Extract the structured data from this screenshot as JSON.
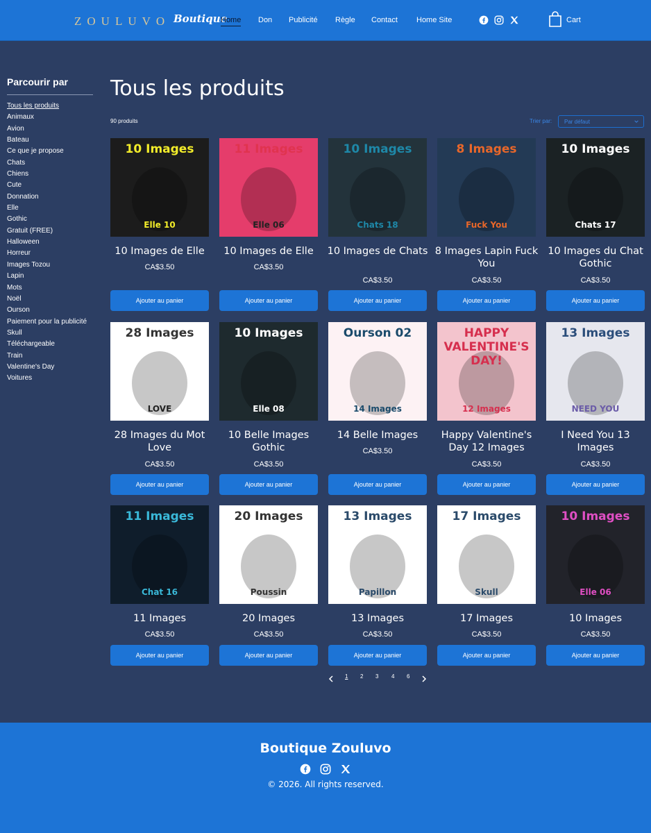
{
  "header": {
    "logo": "ZOULUVO",
    "logo_sub": "Boutique",
    "nav": [
      "Home",
      "Don",
      "Publicité",
      "Règle",
      "Contact",
      "Home Site"
    ],
    "cart": "Cart",
    "social_icons": [
      "facebook-icon",
      "instagram-icon",
      "x-icon"
    ]
  },
  "sidebar": {
    "title": "Parcourir par",
    "items": [
      "Tous les produits",
      "Animaux",
      "Avion",
      "Bateau",
      "Ce que je propose",
      "Chats",
      "Chiens",
      "Cute",
      "Donnation",
      "Elle",
      "Gothic",
      "Gratuit (FREE)",
      "Halloween",
      "Horreur",
      "Images Tozou",
      "Lapin",
      "Mots",
      "Noël",
      "Ourson",
      "Paiement pour la publicité",
      "Skull",
      "Téléchargeable",
      "Train",
      "Valentine's Day",
      "Voitures"
    ]
  },
  "main": {
    "title": "Tous les produits",
    "count": "90 produits",
    "sort_label": "Trier par:",
    "sort_value": "Par défaut",
    "add_label": "Ajouter au panier"
  },
  "products": [
    {
      "name": "10 Images de Elle",
      "price": "CA$3.50",
      "img_top": "10 Images",
      "img_bottom": "Elle 10",
      "bg": "#1c1c1c",
      "top_color": "#f2ec2a",
      "bottom_color": "#f2ec2a"
    },
    {
      "name": "10 Images de Elle",
      "price": "CA$3.50",
      "img_top": "11 Images",
      "img_bottom": "Elle 06",
      "bg": "#e53d6b",
      "top_color": "#e0334f",
      "bottom_color": "#222222"
    },
    {
      "name": "10 Images de Chats",
      "price": "CA$3.50",
      "img_top": "10 Images",
      "img_bottom": "Chats 18",
      "bg": "#23333b",
      "top_color": "#1e88a8",
      "bottom_color": "#1e88a8"
    },
    {
      "name": "8 Images Lapin Fuck You",
      "price": "CA$3.50",
      "img_top": "8 Images",
      "img_bottom": "Fuck You",
      "bg": "#233a55",
      "top_color": "#e8672a",
      "bottom_color": "#e8672a"
    },
    {
      "name": "10 Images du Chat Gothic",
      "price": "CA$3.50",
      "img_top": "10 Images",
      "img_bottom": "Chats 17",
      "bg": "#1b2224",
      "top_color": "#ffffff",
      "bottom_color": "#ffffff"
    },
    {
      "name": "28 Images du Mot Love",
      "price": "CA$3.50",
      "img_top": "28 Images",
      "img_bottom": "LOVE",
      "bg": "#ffffff",
      "top_color": "#333333",
      "bottom_color": "#222222"
    },
    {
      "name": "10 Belle Images Gothic",
      "price": "CA$3.50",
      "img_top": "10 Images",
      "img_bottom": "Elle 08",
      "bg": "#1e2a2e",
      "top_color": "#ffffff",
      "bottom_color": "#ffffff"
    },
    {
      "name": "14 Belle Images",
      "price": "CA$3.50",
      "img_top": "Ourson 02",
      "img_bottom": "14 Images",
      "bg": "#fdf2f4",
      "top_color": "#1b4b6b",
      "bottom_color": "#1b4b6b"
    },
    {
      "name": "Happy Valentine's Day 12 Images",
      "price": "CA$3.50",
      "img_top": "HAPPY VALENTINE'S DAY!",
      "img_bottom": "12 Images",
      "bg": "#f3c4cd",
      "top_color": "#d62f4e",
      "bottom_color": "#d62f4e"
    },
    {
      "name": "I Need You 13 Images",
      "price": "CA$3.50",
      "img_top": "13 Images",
      "img_bottom": "NEED YOU",
      "bg": "#e6e7ee",
      "top_color": "#2a4d7a",
      "bottom_color": "#6b5ca8"
    },
    {
      "name": "11 Images",
      "price": "CA$3.50",
      "img_top": "11 Images",
      "img_bottom": "Chat 16",
      "bg": "#0f1d2b",
      "top_color": "#3ab8d8",
      "bottom_color": "#3ab8d8"
    },
    {
      "name": "20 Images",
      "price": "CA$3.50",
      "img_top": "20 Images",
      "img_bottom": "Poussin",
      "bg": "#ffffff",
      "top_color": "#333333",
      "bottom_color": "#333333"
    },
    {
      "name": "13 Images",
      "price": "CA$3.50",
      "img_top": "13 Images",
      "img_bottom": "Papillon",
      "bg": "#ffffff",
      "top_color": "#2a4a6a",
      "bottom_color": "#2a4a6a"
    },
    {
      "name": "17 Images",
      "price": "CA$3.50",
      "img_top": "17 Images",
      "img_bottom": "Skull",
      "bg": "#ffffff",
      "top_color": "#2a4a6a",
      "bottom_color": "#2a4a6a"
    },
    {
      "name": "10 Images",
      "price": "CA$3.50",
      "img_top": "10 Images",
      "img_bottom": "Elle 06",
      "bg": "#22232a",
      "top_color": "#e04fc4",
      "bottom_color": "#e04fc4"
    }
  ],
  "pagination": [
    "1",
    "2",
    "3",
    "4",
    "6"
  ],
  "footer": {
    "title": "Boutique Zouluvo",
    "copyright": "© 2026. All rights reserved."
  },
  "colors": {
    "accent": "#1d74d6",
    "background": "#2c3e63"
  }
}
